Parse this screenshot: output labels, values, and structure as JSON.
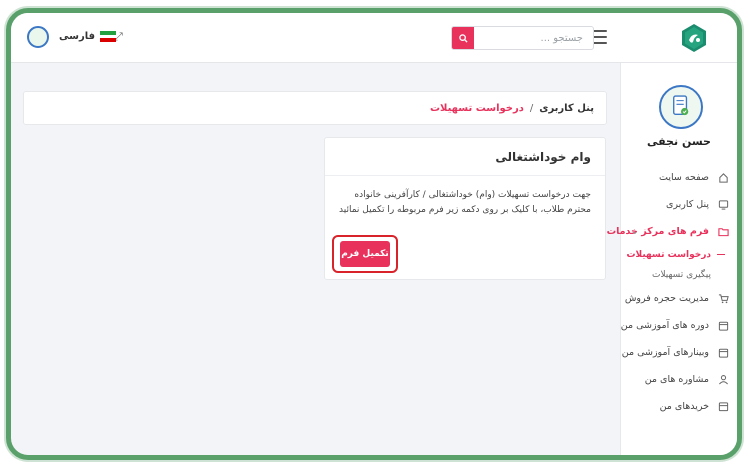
{
  "header": {
    "search_placeholder": "جستجو ...",
    "language": "فارسی"
  },
  "sidebar": {
    "user_name": "حسن نجفی",
    "items": [
      {
        "label": "صفحه سایت"
      },
      {
        "label": "پنل کاربری"
      },
      {
        "label": "فرم های مرکز خدمات"
      },
      {
        "label": "درخواست تسهیلات"
      },
      {
        "label": "پیگیری تسهیلات"
      },
      {
        "label": "مدیریت حجره فروش"
      },
      {
        "label": "دوره های آموزشی من"
      },
      {
        "label": "وبینارهای آموزشی من"
      },
      {
        "label": "مشاوره های من"
      },
      {
        "label": "خریدهای من"
      }
    ]
  },
  "breadcrumb": {
    "home": "پنل کاربری",
    "separator": "/",
    "current": "درخواست تسهیلات"
  },
  "card": {
    "title": "وام خوداشتغالی",
    "description": "جهت درخواست تسهیلات (وام) خوداشتغالی / کارآفرینی خانواده محترم طلاب، با کلیک بر روی دکمه زیر فرم مربوطه را تکمیل نمائید",
    "button_label": "تکمیل فرم"
  },
  "colors": {
    "accent": "#e8315b",
    "highlight_border": "#d8232a",
    "frame": "#5aa06a"
  }
}
